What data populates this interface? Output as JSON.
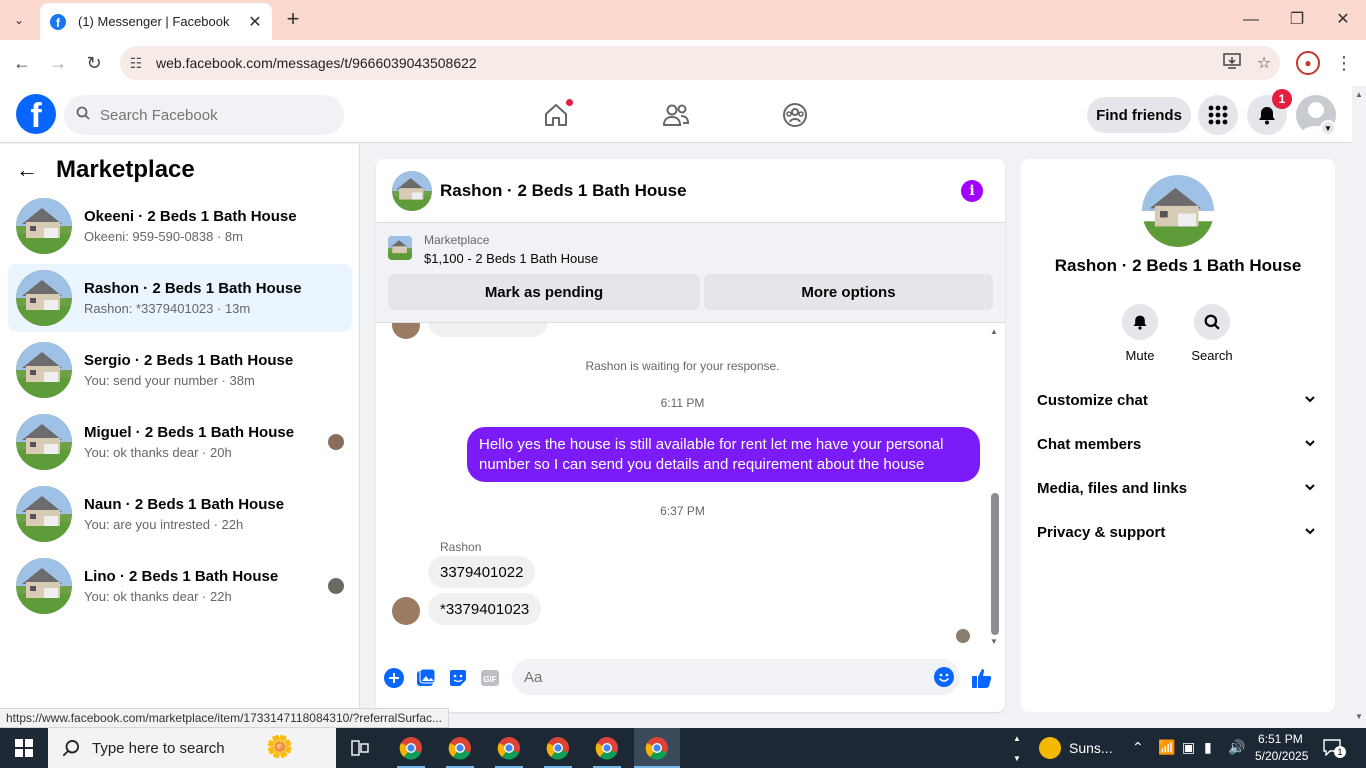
{
  "browser": {
    "tab_title": "(1) Messenger | Facebook",
    "url": "web.facebook.com/messages/t/9666039043508622",
    "status_url": "https://www.facebook.com/marketplace/item/1733147118084310/?referralSurfac..."
  },
  "fb": {
    "search_placeholder": "Search Facebook",
    "find_friends": "Find friends",
    "notification_count": "1"
  },
  "sidebar": {
    "title": "Marketplace",
    "conversations": [
      {
        "name": "Okeeni · 2 Beds 1 Bath House",
        "preview": "Okeeni: 959-590-0838 · 8m"
      },
      {
        "name": "Rashon · 2 Beds 1 Bath House",
        "preview": "Rashon: *3379401023 · 13m"
      },
      {
        "name": "Sergio · 2 Beds 1 Bath House",
        "preview": "You: send your number · 38m"
      },
      {
        "name": "Miguel · 2 Beds 1 Bath House",
        "preview": "You: ok thanks dear · 20h"
      },
      {
        "name": "Naun · 2 Beds 1 Bath House",
        "preview": "You: are you intrested · 22h"
      },
      {
        "name": "Lino · 2 Beds 1 Bath House",
        "preview": "You: ok thanks dear · 22h"
      }
    ]
  },
  "chat": {
    "title": "Rashon · 2 Beds 1 Bath House",
    "listing_label": "Marketplace",
    "listing_price": "$1,100 - 2 Beds 1 Bath House",
    "mark_pending": "Mark as pending",
    "more_options": "More options",
    "waiting_text": "Rashon is waiting for your response.",
    "time1": "6:11 PM",
    "outgoing_message": "Hello yes the house is still available for rent let me have your personal number so I can send you details and requirement about the house",
    "time2": "6:37 PM",
    "sender": "Rashon",
    "incoming1": "3379401022",
    "incoming2": "*3379401023",
    "input_placeholder": "Aa"
  },
  "details": {
    "name": "Rashon · 2 Beds 1 Bath House",
    "mute": "Mute",
    "search": "Search",
    "sections": [
      "Customize chat",
      "Chat members",
      "Media, files and links",
      "Privacy & support"
    ]
  },
  "taskbar": {
    "search_text": "Type here to search",
    "weather": "Suns...",
    "time": "6:51 PM",
    "date": "5/20/2025",
    "notif": "1"
  },
  "colors": {
    "fb_blue": "#0866ff",
    "messenger_purple": "#7b1bf7",
    "tab_bar": "#fbd9cf"
  }
}
